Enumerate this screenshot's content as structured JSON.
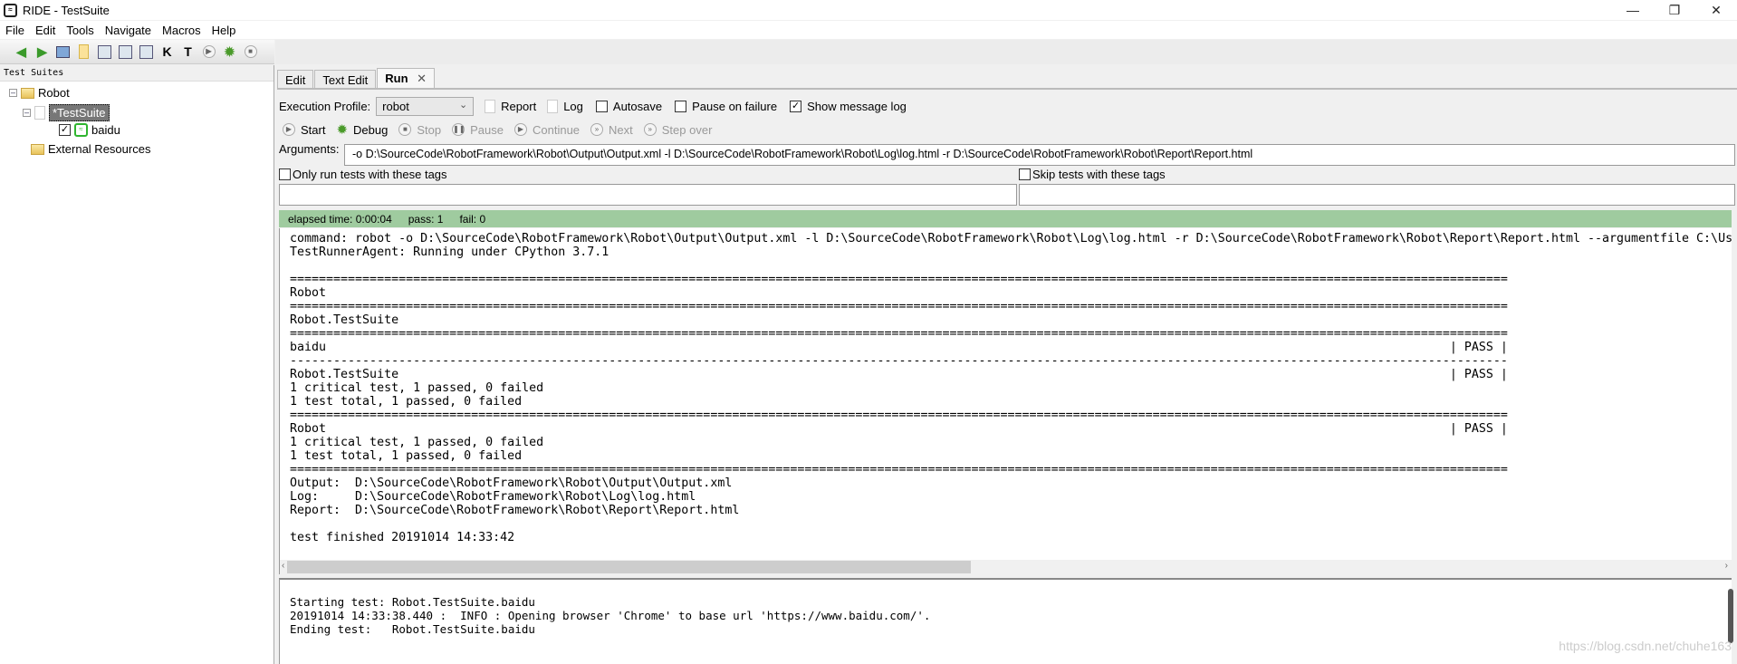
{
  "window": {
    "title": "RIDE - TestSuite",
    "minimize": "—",
    "maximize": "❐",
    "close": "✕"
  },
  "menu": [
    "File",
    "Edit",
    "Tools",
    "Navigate",
    "Macros",
    "Help"
  ],
  "toolbar_icons": [
    "arrow-left-icon",
    "arrow-right-icon",
    "open-folder-icon",
    "new-folder-icon",
    "save-icon",
    "save-as-icon",
    "save-all-icon",
    "keyword-search-icon",
    "test-search-icon",
    "run-icon",
    "debug-icon",
    "stop-icon"
  ],
  "tree": {
    "header": "Test Suites",
    "root": "Robot",
    "suite": "*TestSuite",
    "test": "baidu",
    "external": "External Resources"
  },
  "tabs": [
    {
      "label": "Edit"
    },
    {
      "label": "Text Edit"
    },
    {
      "label": "Run",
      "active": true
    }
  ],
  "run": {
    "profile_label": "Execution Profile:",
    "profile_value": "robot",
    "report": "Report",
    "log": "Log",
    "autosave": "Autosave",
    "autosave_checked": false,
    "pause_on_failure": "Pause on failure",
    "pause_checked": false,
    "show_message_log": "Show message log",
    "show_message_log_checked": true,
    "start": "Start",
    "debug": "Debug",
    "stop": "Stop",
    "pause": "Pause",
    "continue": "Continue",
    "next": "Next",
    "step_over": "Step over",
    "arguments_label": "Arguments:",
    "arguments_value": "-o D:\\SourceCode\\RobotFramework\\Robot\\Output\\Output.xml -l D:\\SourceCode\\RobotFramework\\Robot\\Log\\log.html -r D:\\SourceCode\\RobotFramework\\Robot\\Report\\Report.html",
    "only_run_tags": "Only run tests with these tags",
    "skip_tags": "Skip tests with these tags"
  },
  "status": {
    "elapsed": "elapsed time: 0:00:04",
    "pass": "pass: 1",
    "fail": "fail: 0",
    "color": "#9fcb9f"
  },
  "output": {
    "command": "command: robot -o D:\\SourceCode\\RobotFramework\\Robot\\Output\\Output.xml -l D:\\SourceCode\\RobotFramework\\Robot\\Log\\log.html -r D:\\SourceCode\\RobotFramework\\Robot\\Report\\Report.html --argumentfile C:\\Us",
    "agent": "TestRunnerAgent: Running under CPython 3.7.1",
    "sep_eq": "========================================================================================================================================================================",
    "sep_dash": "------------------------------------------------------------------------------------------------------------------------------------------------------------------------",
    "robot": "Robot",
    "suite": "Robot.TestSuite",
    "test": "baidu",
    "pass_status": "| PASS |",
    "critical": "1 critical test, 1 passed, 0 failed",
    "total": "1 test total, 1 passed, 0 failed",
    "output_path": "Output:  D:\\SourceCode\\RobotFramework\\Robot\\Output\\Output.xml",
    "log_path": "Log:     D:\\SourceCode\\RobotFramework\\Robot\\Log\\log.html",
    "report_path": "Report:  D:\\SourceCode\\RobotFramework\\Robot\\Report\\Report.html",
    "finished": "test finished 20191014 14:33:42"
  },
  "message_log": [
    "Starting test: Robot.TestSuite.baidu",
    "20191014 14:33:38.440 :  INFO : Opening browser 'Chrome' to base url 'https://www.baidu.com/'.",
    "Ending test:   Robot.TestSuite.baidu"
  ],
  "watermark": "https://blog.csdn.net/chuhe163"
}
